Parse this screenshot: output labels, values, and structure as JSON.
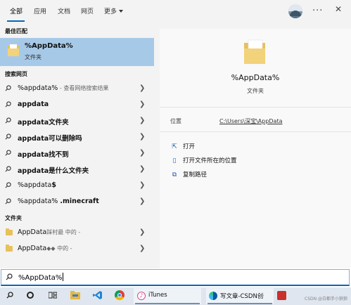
{
  "tabs": [
    {
      "label": "全部",
      "active": true
    },
    {
      "label": "应用"
    },
    {
      "label": "文档"
    },
    {
      "label": "网页"
    },
    {
      "label": "更多"
    }
  ],
  "header_icons": [
    "avatar",
    "more-options-icon",
    "close-icon"
  ],
  "sections": {
    "best_match": "最佳匹配",
    "web_search": "搜索网页",
    "folders": "文件夹"
  },
  "best_match": {
    "title": "%AppData%",
    "type": "文件夹"
  },
  "web_results": [
    {
      "prefix": "%appdata%",
      "bold": "",
      "sub": " - 查看网络搜索结果"
    },
    {
      "prefix": "",
      "bold": "appdata",
      "sub": ""
    },
    {
      "prefix": "",
      "bold": "appdata文件夹",
      "sub": ""
    },
    {
      "prefix": "",
      "bold": "appdata可以删除吗",
      "sub": ""
    },
    {
      "prefix": "",
      "bold": "appdata找不到",
      "sub": ""
    },
    {
      "prefix": "",
      "bold": "appdata是什么文件夹",
      "sub": ""
    },
    {
      "prefix": "%appdata",
      "bold": "$",
      "sub": ""
    },
    {
      "prefix": "%appdata% ",
      "bold": ".minecraft",
      "sub": ""
    }
  ],
  "folder_results": [
    {
      "name": "AppData",
      "sub": "踩村最 中的 -"
    },
    {
      "name": "AppData",
      "sub": "◆◆ 中的 -"
    }
  ],
  "preview": {
    "title": "%AppData%",
    "type": "文件夹",
    "location_label": "位置",
    "location_value": "C:\\Users\\深宝\\AppData",
    "actions": [
      {
        "icon": "open-icon",
        "label": "打开"
      },
      {
        "icon": "open-location-icon",
        "label": "打开文件所在的位置"
      },
      {
        "icon": "copy-path-icon",
        "label": "复制路径"
      }
    ]
  },
  "search": {
    "value": "%AppData%"
  },
  "taskbar": {
    "itunes_label": "iTunes",
    "edge_label": "写文章-CSDN创作..."
  },
  "watermark": "CSDN @白都手小狼狼",
  "colors": {
    "accent": "#0067c0",
    "selected": "#a7c9e8",
    "folder": "#e8c15b"
  }
}
